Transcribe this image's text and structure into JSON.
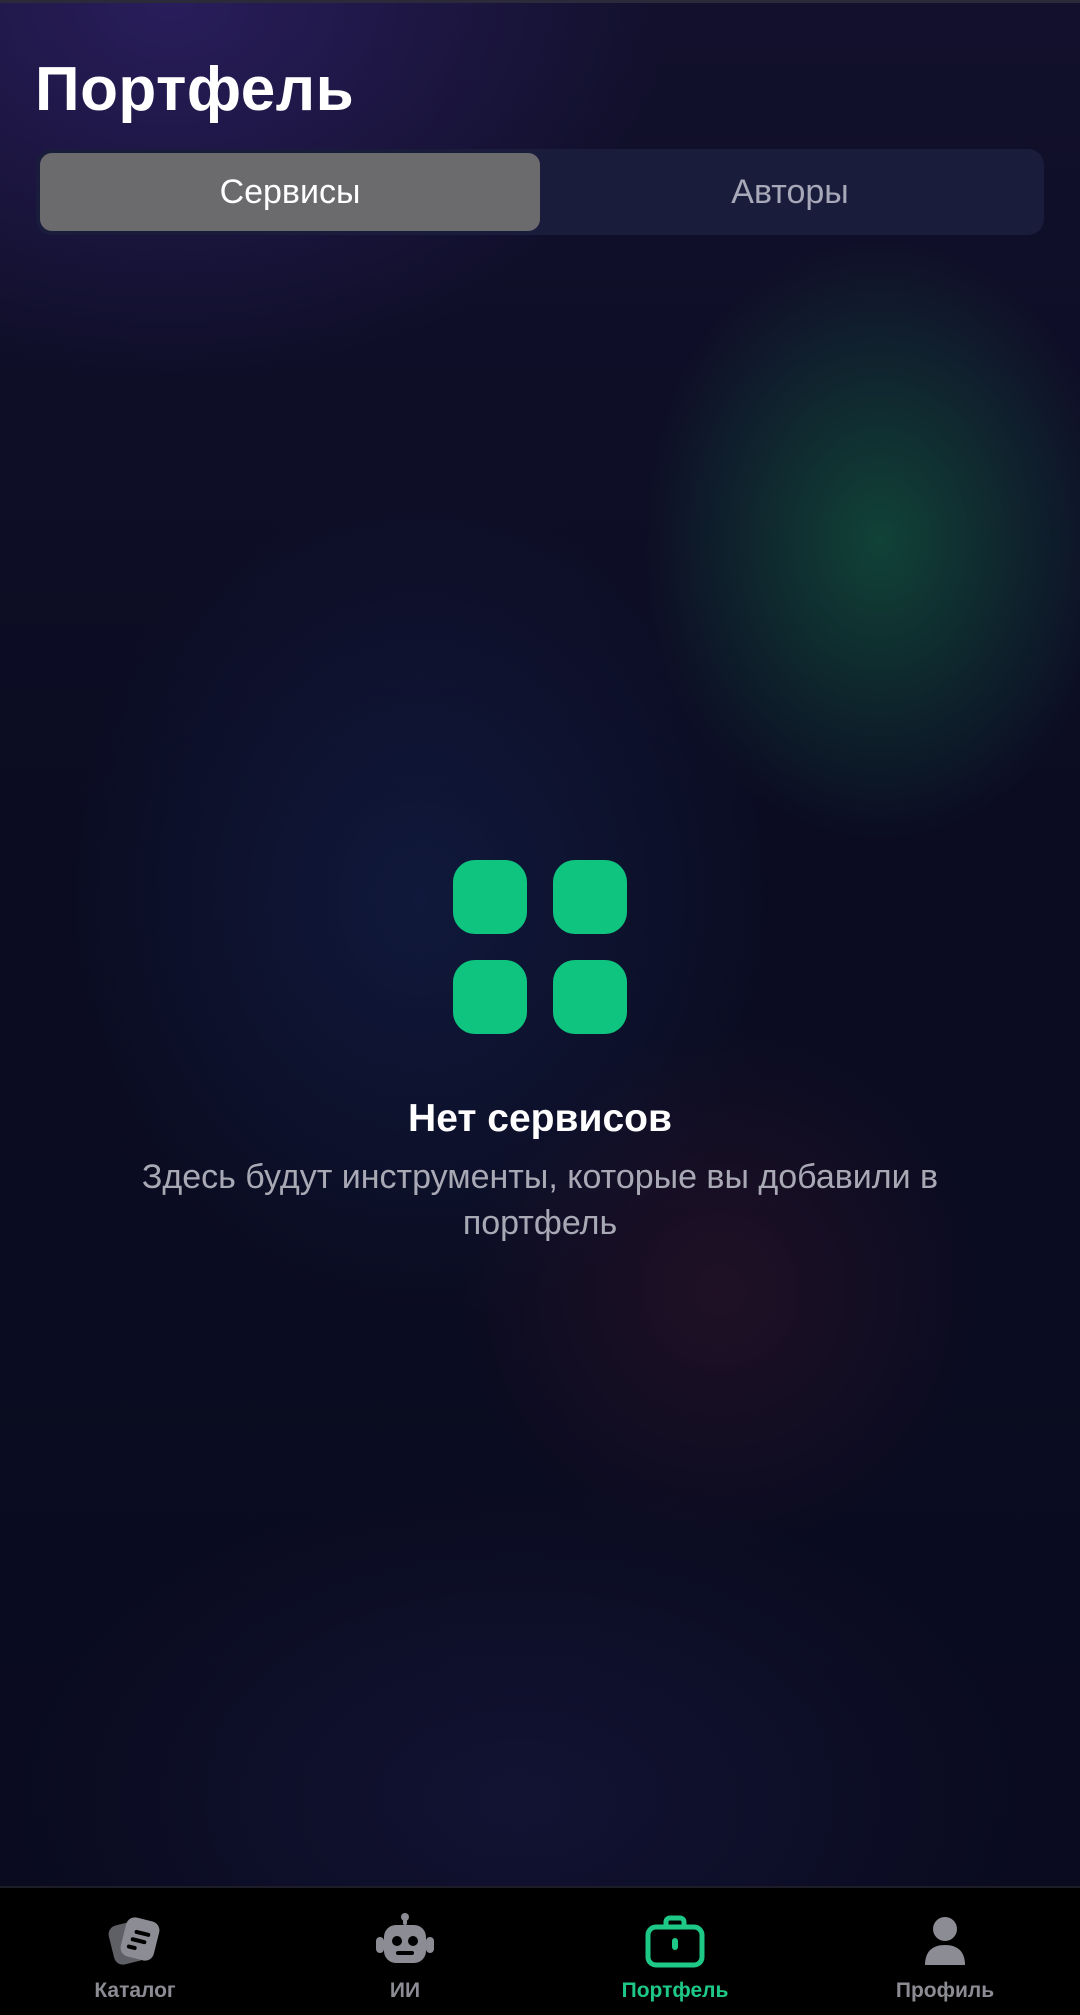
{
  "header": {
    "title": "Портфель"
  },
  "segmented_control": {
    "tabs": [
      {
        "label": "Сервисы",
        "active": true
      },
      {
        "label": "Авторы",
        "active": false
      }
    ]
  },
  "empty_state": {
    "icon": "grid-four-squares-icon",
    "title": "Нет сервисов",
    "description": "Здесь будут инструменты, которые вы добавили в портфель"
  },
  "bottom_nav": {
    "items": [
      {
        "label": "Каталог",
        "icon": "catalog-cards-icon",
        "active": false
      },
      {
        "label": "ИИ",
        "icon": "robot-icon",
        "active": false
      },
      {
        "label": "Портфель",
        "icon": "briefcase-icon",
        "active": true
      },
      {
        "label": "Профиль",
        "icon": "profile-person-icon",
        "active": false
      }
    ]
  },
  "colors": {
    "accent": "#0fc47e",
    "active_nav": "#1ec987",
    "inactive_nav": "#8c8c94",
    "segment_active": "#6b6b6e",
    "segment_bg": "#1a1c3c"
  }
}
